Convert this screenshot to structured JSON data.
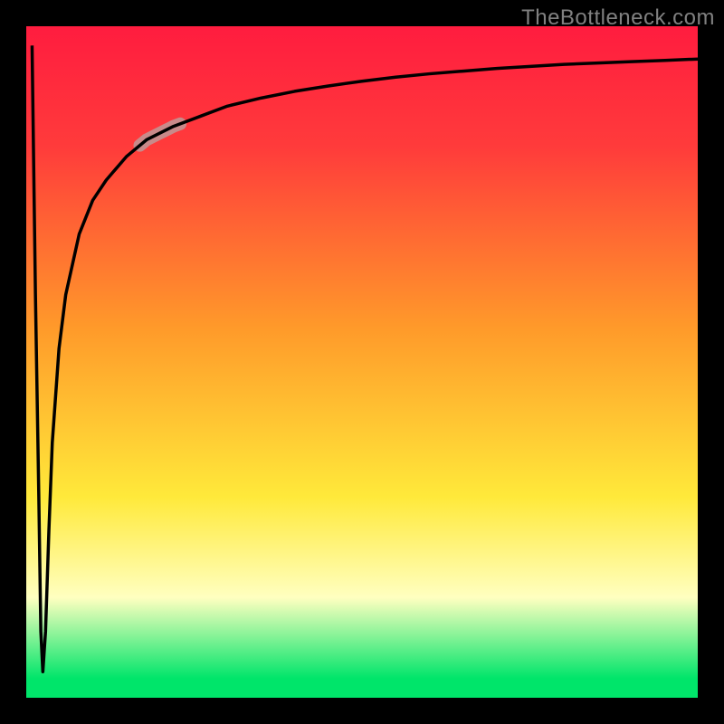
{
  "attribution": "TheBottleneck.com",
  "colors": {
    "frame": "#000000",
    "curve": "#000000",
    "highlight": "#c88a8a",
    "gradient_top": "#ff1c3f",
    "gradient_mid_red": "#ff3b3b",
    "gradient_orange": "#ff9a2a",
    "gradient_yellow": "#ffe93a",
    "gradient_pale": "#ffffc0",
    "gradient_green": "#00e56a"
  },
  "chart_data": {
    "type": "line",
    "title": "",
    "xlabel": "",
    "ylabel": "",
    "xlim": [
      0,
      100
    ],
    "ylim": [
      0,
      100
    ],
    "series": [
      {
        "name": "curve",
        "x": [
          1,
          1.5,
          2,
          2.3,
          2.6,
          3,
          3.5,
          4,
          5,
          6,
          8,
          10,
          12,
          15,
          18,
          22,
          26,
          30,
          35,
          40,
          45,
          50,
          55,
          60,
          65,
          70,
          75,
          80,
          85,
          90,
          95,
          100
        ],
        "y": [
          97,
          60,
          30,
          10,
          4,
          10,
          25,
          38,
          52,
          60,
          69,
          74,
          77,
          80.5,
          83,
          85,
          86.5,
          88,
          89.2,
          90.2,
          91,
          91.7,
          92.3,
          92.8,
          93.2,
          93.6,
          93.9,
          94.2,
          94.4,
          94.6,
          94.8,
          95
        ]
      }
    ],
    "annotations": [
      {
        "name": "highlight-segment",
        "x_range": [
          17,
          23
        ],
        "note": "thicker muted-red segment on the curve"
      }
    ]
  }
}
